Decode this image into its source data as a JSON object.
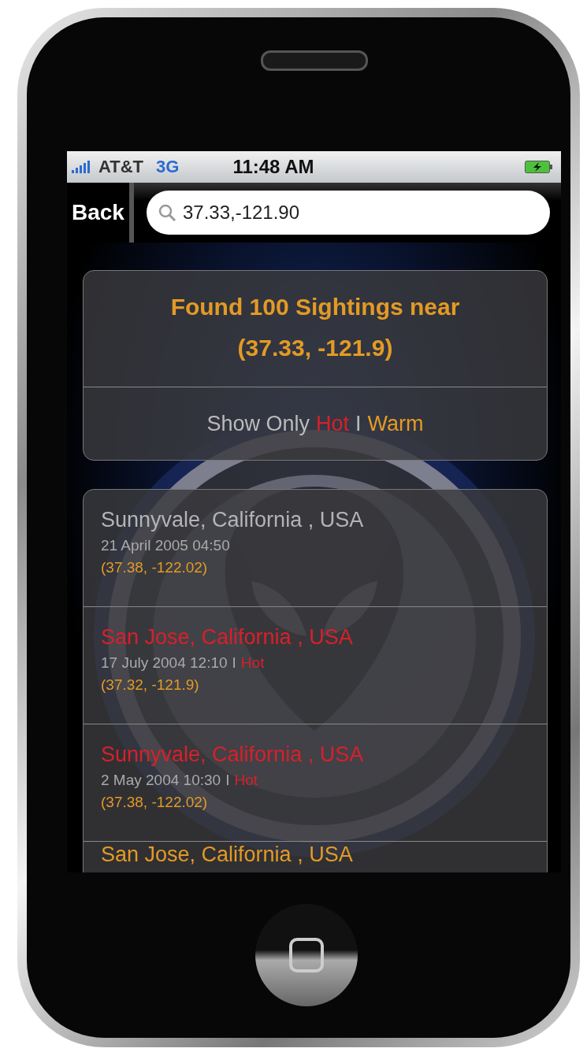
{
  "status_bar": {
    "carrier": "AT&T",
    "network": "3G",
    "time": "11:48 AM"
  },
  "nav_bar": {
    "back_button": "Back",
    "search": {
      "value": "37.33,-121.90"
    }
  },
  "summary": {
    "title": "Found 100 Sightings near (37.33, -121.9)",
    "filter_label": "Show Only",
    "filters": [
      {
        "label": "Hot",
        "kind": "hot"
      },
      {
        "label": "Warm",
        "kind": "warm"
      }
    ],
    "filter_separator": "I"
  },
  "sightings": [
    {
      "place": "Sunnyvale, California , USA",
      "kind": "none",
      "date": "21 April 2005 04:50",
      "coords": "(37.38, -122.02)"
    },
    {
      "place": "San Jose, California , USA",
      "kind": "hot",
      "date": "17 July 2004 12:10",
      "separator": "I",
      "heat_label": "Hot",
      "coords": "(37.32, -121.9)"
    },
    {
      "place": "Sunnyvale, California , USA",
      "kind": "hot",
      "date": "2 May 2004 10:30",
      "separator": "I",
      "heat_label": "Hot",
      "coords": "(37.38, -122.02)"
    },
    {
      "place": "San Jose, California , USA",
      "kind": "warm"
    }
  ]
}
